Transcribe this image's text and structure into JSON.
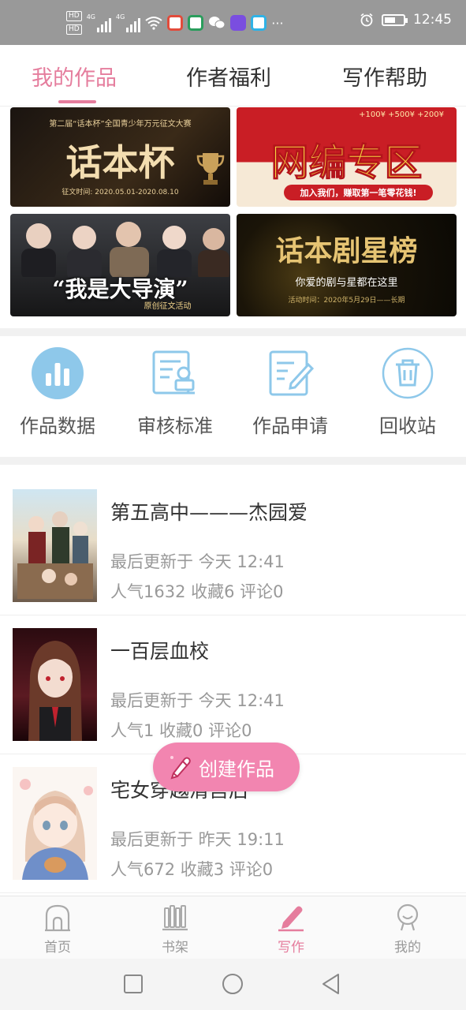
{
  "status_bar": {
    "time": "12:45",
    "hd_label": "HD",
    "network_4g": "4G",
    "more": "···",
    "battery_level": 0.6
  },
  "top_tabs": [
    "我的作品",
    "作者福利",
    "写作帮助"
  ],
  "active_tab": 0,
  "banners": [
    {
      "title": "话本杯",
      "subtitle": "第二届“话本杯”全国青少年万元征文大赛",
      "caption": "征文时间: 2020.05.01-2020.08.10"
    },
    {
      "title": "网编专区",
      "subtitle": "加入我们，赚取第一笔零花钱!",
      "caption": "+100¥  +500¥  +200¥"
    },
    {
      "title": "“我是大导演”",
      "subtitle": "原创征文活动"
    },
    {
      "title": "话本剧星榜",
      "subtitle": "你爱的剧与星都在这里",
      "caption": "活动时间：2020年5月29日——长期"
    }
  ],
  "tools": [
    {
      "label": "作品数据",
      "icon": "bar-chart-icon"
    },
    {
      "label": "审核标准",
      "icon": "review-standard-icon"
    },
    {
      "label": "作品申请",
      "icon": "edit-document-icon"
    },
    {
      "label": "回收站",
      "icon": "trash-icon"
    }
  ],
  "works": [
    {
      "title": "第五高中———杰园爱",
      "updated": "最后更新于 今天 12:41",
      "stats": "人气1632 收藏6 评论0"
    },
    {
      "title": "一百层血校",
      "updated": "最后更新于 今天 12:41",
      "stats": "人气1 收藏0 评论0"
    },
    {
      "title": "宅女穿越清宫后",
      "updated": "最后更新于 昨天 19:11",
      "stats": "人气672 收藏3 评论0"
    }
  ],
  "fab": {
    "label": "创建作品",
    "icon": "pencil-icon"
  },
  "bottom_nav": [
    {
      "label": "首页",
      "icon": "home-icon"
    },
    {
      "label": "书架",
      "icon": "bookshelf-icon"
    },
    {
      "label": "写作",
      "icon": "pen-icon"
    },
    {
      "label": "我的",
      "icon": "profile-icon"
    }
  ],
  "active_nav": 2,
  "colors": {
    "accent": "#e57d9d",
    "fab": "#f285b0",
    "tool_blue": "#8ec8ea"
  }
}
